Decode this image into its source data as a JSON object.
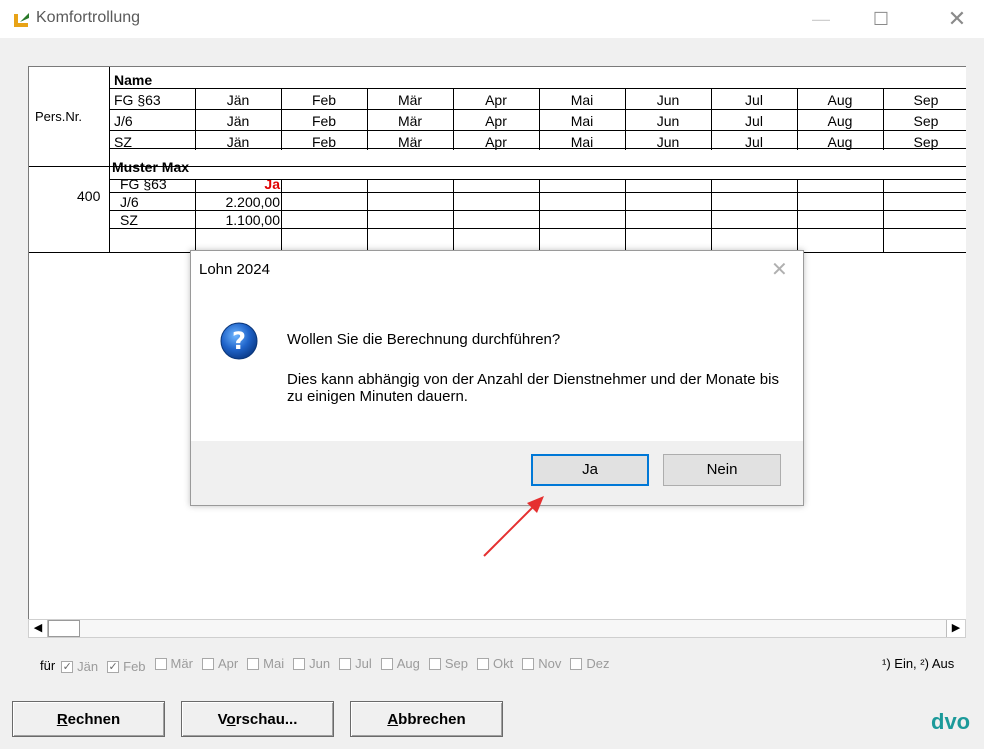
{
  "window": {
    "title": "Komfortrollung"
  },
  "grid": {
    "header": {
      "pers_label": "Pers.Nr.",
      "name_label": "Name",
      "row_labels": [
        "FG §63",
        "J/6",
        "SZ"
      ],
      "months": [
        "Jän",
        "Feb",
        "Mär",
        "Apr",
        "Mai",
        "Jun",
        "Jul",
        "Aug",
        "Sep"
      ]
    },
    "employee": {
      "pers_nr": "400",
      "name": "Muster Max",
      "row_labels": [
        "FG §63",
        "J/6",
        "SZ"
      ],
      "values": [
        "Ja",
        "2.200,00",
        "1.100,00"
      ],
      "ja_color": "#e00000"
    }
  },
  "filter": {
    "label": "für",
    "months": [
      {
        "label": "Jän",
        "checked": true
      },
      {
        "label": "Feb",
        "checked": true
      },
      {
        "label": "Mär",
        "checked": false
      },
      {
        "label": "Apr",
        "checked": false
      },
      {
        "label": "Mai",
        "checked": false
      },
      {
        "label": "Jun",
        "checked": false
      },
      {
        "label": "Jul",
        "checked": false
      },
      {
        "label": "Aug",
        "checked": false
      },
      {
        "label": "Sep",
        "checked": false
      },
      {
        "label": "Okt",
        "checked": false
      },
      {
        "label": "Nov",
        "checked": false
      },
      {
        "label": "Dez",
        "checked": false
      }
    ],
    "legend": "¹) Ein, ²) Aus"
  },
  "buttons": {
    "rechnen": "Rechnen",
    "vorschau": "Vorschau...",
    "abbrechen": "Abbrechen"
  },
  "brand": {
    "logo": "dvo",
    "color": "#1c9a9a"
  },
  "dialog": {
    "title": "Lohn 2024",
    "question": "Wollen Sie die Berechnung durchführen?",
    "detail": "Dies kann abhängig von der Anzahl der Dienstnehmer und der Monate bis zu einigen Minuten dauern.",
    "yes": "Ja",
    "no": "Nein"
  },
  "annotation": {
    "arrow_color": "#e53030"
  }
}
